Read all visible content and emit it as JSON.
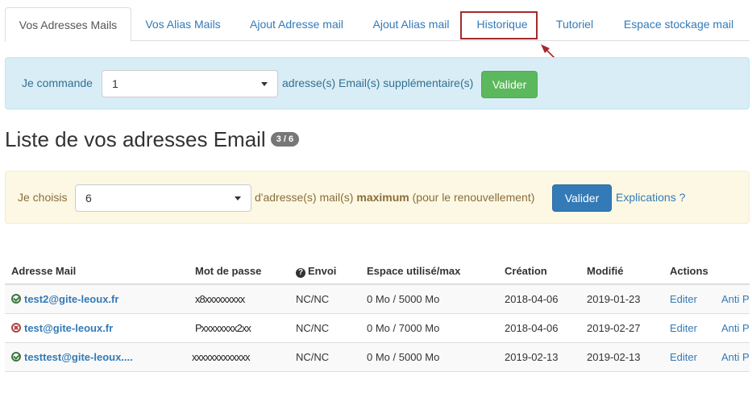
{
  "tabs": [
    {
      "label": "Vos Adresses Mails",
      "active": true
    },
    {
      "label": "Vos Alias Mails"
    },
    {
      "label": "Ajout Adresse mail"
    },
    {
      "label": "Ajout Alias mail"
    },
    {
      "label": "Historique",
      "highlighted": true
    },
    {
      "label": "Tutoriel"
    },
    {
      "label": "Espace stockage mail"
    }
  ],
  "order": {
    "prefix": "Je commande",
    "quantity": "1",
    "suffix": "adresse(s) Email(s) supplémentaire(s)",
    "submit": "Valider"
  },
  "list": {
    "title": "Liste de vos adresses Email",
    "badge": "3 / 6"
  },
  "choose": {
    "prefix": "Je choisis",
    "quantity": "6",
    "suffix_before": "d'adresse(s) mail(s)",
    "suffix_bold": "maximum",
    "suffix_after": "(pour le renouvellement)",
    "submit": "Valider",
    "help_link": "Explications ?"
  },
  "table": {
    "headers": {
      "email": "Adresse Mail",
      "password": "Mot de passe",
      "send": "Envoi",
      "space": "Espace utilisé/max",
      "created": "Création",
      "modified": "Modifié",
      "actions": "Actions"
    },
    "rows": [
      {
        "status": "ok",
        "email": "test2@gite-leoux.fr",
        "password": "x8xxxxxxxxx",
        "send": "NC/NC",
        "space": "0 Mo / 5000 Mo",
        "created": "2018-04-06",
        "modified": "2019-01-23",
        "edit": "Editer",
        "spam": "Anti P"
      },
      {
        "status": "error",
        "email": "test@gite-leoux.fr",
        "password": "Pxxxxxxxx2xx",
        "send": "NC/NC",
        "space": "0 Mo / 7000 Mo",
        "created": "2018-04-06",
        "modified": "2019-02-27",
        "edit": "Editer",
        "spam": "Anti P"
      },
      {
        "status": "ok",
        "email": "testtest@gite-leoux....",
        "password": "xxxxxxxxxxxxx",
        "send": "NC/NC",
        "space": "0 Mo / 5000 Mo",
        "created": "2019-02-13",
        "modified": "2019-02-13",
        "edit": "Editer",
        "spam": "Anti P"
      }
    ]
  },
  "colors": {
    "accent": "#337ab7",
    "success": "#5cb85c",
    "info_bg": "#d9edf7",
    "warning_bg": "#fcf8e3",
    "highlight": "#a32a2e"
  }
}
